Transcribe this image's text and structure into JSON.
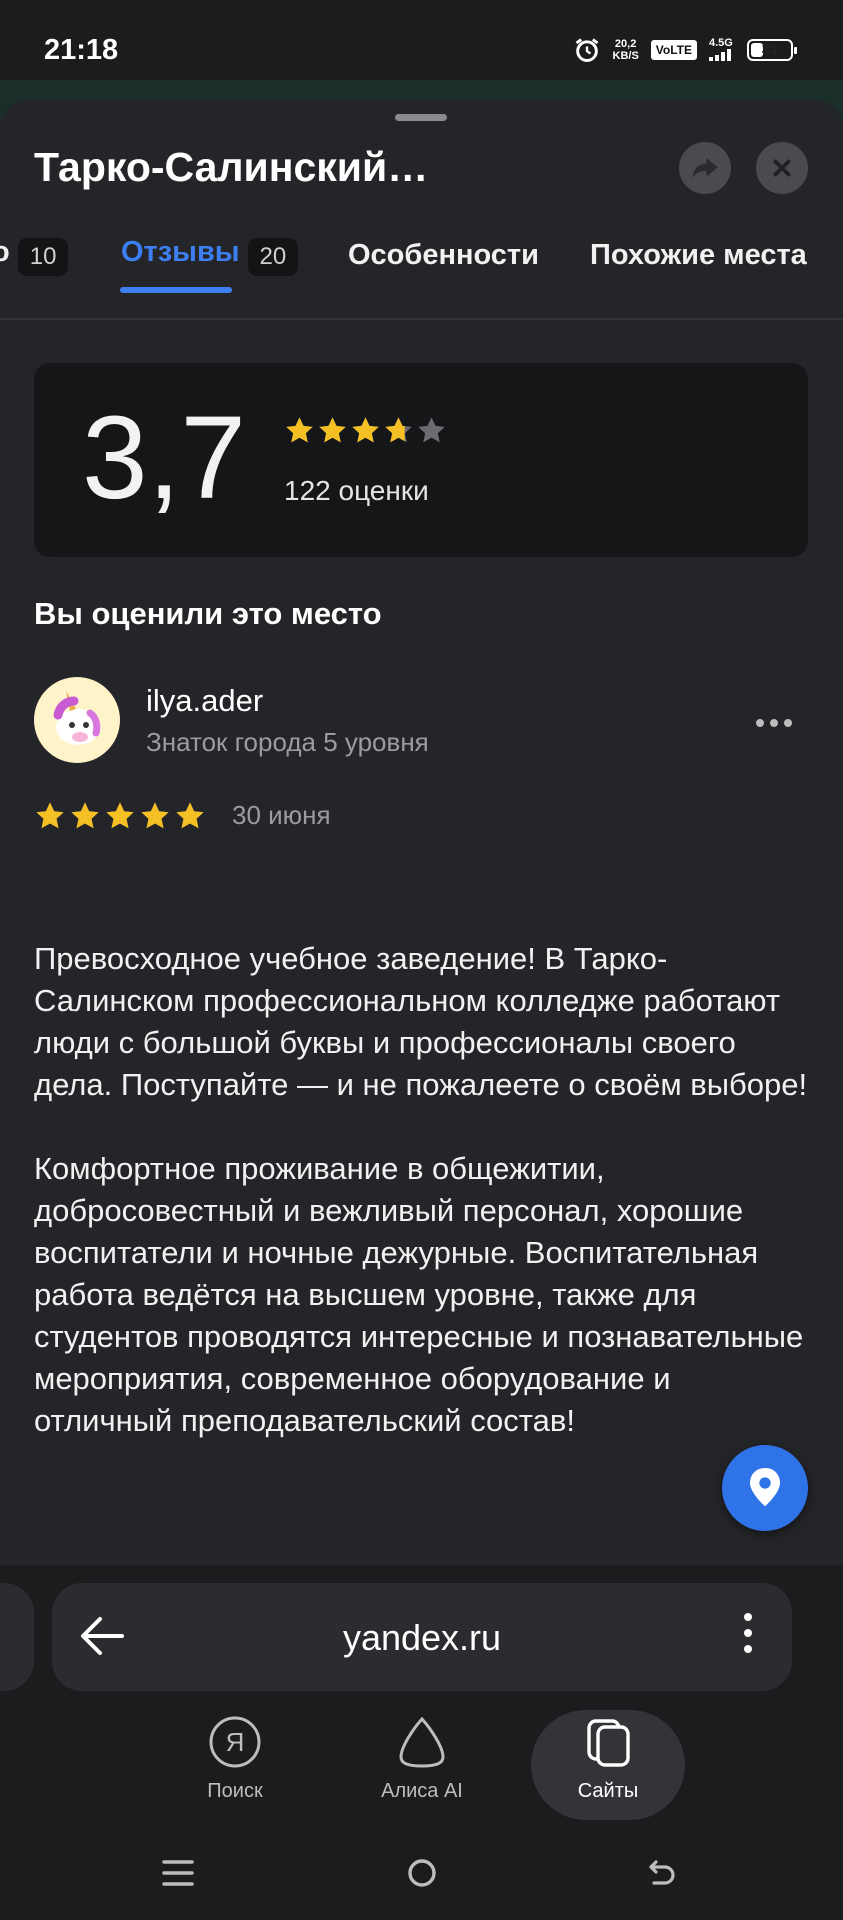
{
  "status_bar": {
    "time": "21:18",
    "net_speed_value": "20,2",
    "net_speed_unit": "KB/S",
    "volte": "VoLTE",
    "network": "4.5G",
    "battery": "31",
    "battery_level": 0.31
  },
  "place": {
    "title": "Тарко-Салинский…"
  },
  "tabs": [
    {
      "label": "",
      "badge": "10"
    },
    {
      "label": "Отзывы",
      "badge": "20",
      "active": true
    },
    {
      "label": "Особенности",
      "badge": ""
    },
    {
      "label": "Похожие места",
      "badge": ""
    }
  ],
  "rating": {
    "value": "3,7",
    "stars": 3.7,
    "count": "122 оценки"
  },
  "my_review": {
    "heading": "Вы оценили это место",
    "user_name": "ilya.ader",
    "user_level": "Знаток города 5 уровня",
    "stars": 5,
    "date": "30 июня",
    "paragraphs": [
      "Превосходное учебное заведение! В Тарко-Салинском профессиональном колледже работают люди с большой буквы и профессионалы своего дела. Поступайте — и не пожалеете о своём выборе!",
      "Комфортное проживание в общежитии, добросовестный и вежливый персонал, хорошие воспитатели и ночные дежурные. Воспитательная работа ведётся на высшем уровне, также для студентов проводятся интересные и познавательные мероприятия, современное оборудование и отличный преподавательский состав!"
    ]
  },
  "browser": {
    "url": "yandex.ru",
    "nav": [
      {
        "label": "Поиск",
        "icon": "yandex-icon"
      },
      {
        "label": "Алиса AI",
        "icon": "alice-icon"
      },
      {
        "label": "Сайты",
        "icon": "sites-icon",
        "active": true
      }
    ]
  },
  "colors": {
    "accent": "#3d7ef1",
    "star": "#f5c024",
    "fab": "#2f73e8"
  }
}
